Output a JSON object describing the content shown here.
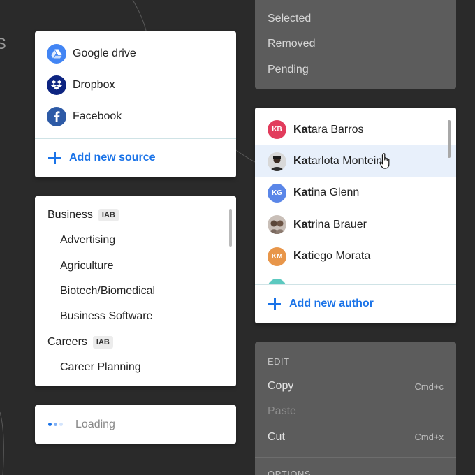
{
  "background_arc_color": "#5a5a5a",
  "edge_text": "S",
  "sources": {
    "items": [
      {
        "label": "Google drive",
        "icon": "google-drive-icon",
        "color": "#4285f4"
      },
      {
        "label": "Dropbox",
        "icon": "dropbox-icon",
        "color": "#0d2481"
      },
      {
        "label": "Facebook",
        "icon": "facebook-icon",
        "color": "#2d5aa6"
      }
    ],
    "add_label": "Add new source"
  },
  "categories": {
    "rows": [
      {
        "label": "Business",
        "badge": "IAB"
      },
      {
        "label": "Advertising"
      },
      {
        "label": "Agriculture"
      },
      {
        "label": "Biotech/Biomedical"
      },
      {
        "label": "Business Software"
      },
      {
        "label": "Careers",
        "badge": "IAB"
      },
      {
        "label": "Career Planning"
      }
    ]
  },
  "loading": {
    "label": "Loading",
    "dot_colors": [
      "#1a73e8",
      "#7fb0f5",
      "#d3e4fc"
    ]
  },
  "status": {
    "items": [
      "Selected",
      "Removed",
      "Pending"
    ]
  },
  "authors": {
    "query": "Kat",
    "items": [
      {
        "match": "Kat",
        "rest": "ara Barros",
        "initials": "KB",
        "color": "#e23c5c"
      },
      {
        "match": "Kat",
        "rest": "arlota Montein",
        "initials": "",
        "color": "#7a6b5e",
        "photo": true
      },
      {
        "match": "Kat",
        "rest": "ina Glenn",
        "initials": "KG",
        "color": "#5a86e8"
      },
      {
        "match": "Kat",
        "rest": "rina Brauer",
        "initials": "",
        "color": "#8a7a70",
        "photo": true
      },
      {
        "match": "Kat",
        "rest": "iego Morata",
        "initials": "KM",
        "color": "#e8964a"
      },
      {
        "match": "",
        "rest": "",
        "initials": "",
        "color": "#5cc9c0"
      }
    ],
    "add_label": "Add new author",
    "accent": "#1a73e8"
  },
  "edit_menu": {
    "section": "EDIT",
    "items": [
      {
        "label": "Copy",
        "shortcut": "Cmd+c",
        "disabled": false
      },
      {
        "label": "Paste",
        "shortcut": "",
        "disabled": true
      },
      {
        "label": "Cut",
        "shortcut": "Cmd+x",
        "disabled": false
      }
    ],
    "section2": "OPTIONS"
  }
}
